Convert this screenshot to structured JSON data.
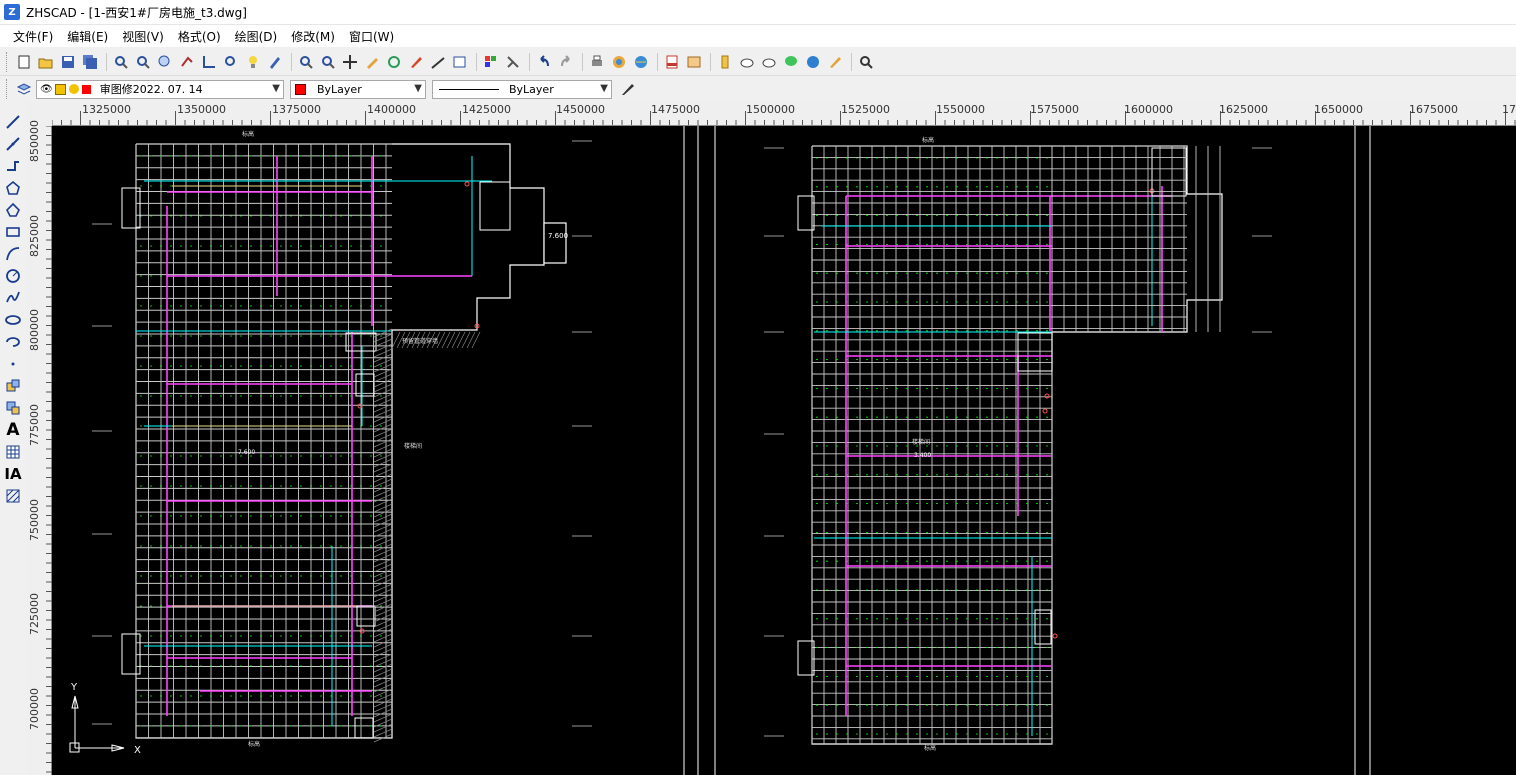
{
  "window": {
    "app_name": "ZHSCAD",
    "title": "ZHSCAD - [1-西安1#厂房电施_t3.dwg]"
  },
  "menu": [
    "文件(F)",
    "编辑(E)",
    "视图(V)",
    "格式(O)",
    "绘图(D)",
    "修改(M)",
    "窗口(W)"
  ],
  "toolbar": {
    "icons": [
      "new-icon",
      "open-icon",
      "save-icon",
      "save-all-icon",
      "zoom-realtime-icon",
      "zoom-window-icon",
      "zoom-extents-icon",
      "pan-icon",
      "measure-icon",
      "zoom-prev-icon",
      "light-icon",
      "paint-icon",
      "zoom-in-icon",
      "zoom-out-icon",
      "move-icon",
      "pencil-icon",
      "rotate-icon",
      "brush-icon",
      "line-icon",
      "export-icon",
      "palette-icon",
      "pick-icon",
      "undo-icon",
      "redo-icon",
      "print-icon",
      "render-icon",
      "globe-icon",
      "pdf-icon",
      "image-icon",
      "layer-icon",
      "cloud-icon",
      "cloud2-icon",
      "comment-icon",
      "help-icon",
      "edit-icon",
      "find-icon"
    ]
  },
  "properties_bar": {
    "layer_value": "审图修2022. 07. 14",
    "color_value": "ByLayer",
    "linetype_value": "ByLayer",
    "colors": {
      "layer_swatch": "#ff0000",
      "color_swatch": "#ff0000",
      "bulb": "#f2c200"
    }
  },
  "left_toolbar": {
    "icons": [
      "line-icon",
      "xline-icon",
      "polyline-icon",
      "polygon-icon",
      "pentagon-icon",
      "rectangle-icon",
      "arc-icon",
      "circle-icon",
      "spline-icon",
      "ellipse-icon",
      "ellipse-arc-icon",
      "point-icon",
      "block-icon",
      "insert-icon",
      "text-icon",
      "table-icon",
      "mtext-icon",
      "hatch-icon"
    ],
    "text_glyph": "A",
    "mtext_glyph": "IA"
  },
  "ruler": {
    "h_labels": [
      "1325000",
      "1350000",
      "1375000",
      "1400000",
      "1425000",
      "1450000",
      "1475000",
      "1500000",
      "1525000",
      "1550000",
      "1575000",
      "1600000",
      "1625000",
      "1650000",
      "1675000",
      "170"
    ],
    "v_labels": [
      "850000",
      "825000",
      "800000",
      "775000",
      "750000",
      "725000",
      "700000"
    ]
  },
  "drawing": {
    "ucs_y": "Y",
    "ucs_x": "X",
    "left_plan": {
      "tag_label": "7.600",
      "note1": "标高",
      "note2": "预留管道穿墙",
      "note3": "楼梯间",
      "level": "7.600",
      "bottom_label": "标高"
    },
    "right_plan": {
      "note1": "楼梯间",
      "level": "3.400",
      "top_label": "标高",
      "bottom_label": "标高"
    },
    "colors": {
      "grid": "#c8c8c8",
      "green": "#00ff00",
      "cyan": "#00ffff",
      "magenta": "#ff44ff",
      "yellow": "#e8e08a",
      "red": "#ff5050",
      "white": "#ffffff"
    }
  }
}
